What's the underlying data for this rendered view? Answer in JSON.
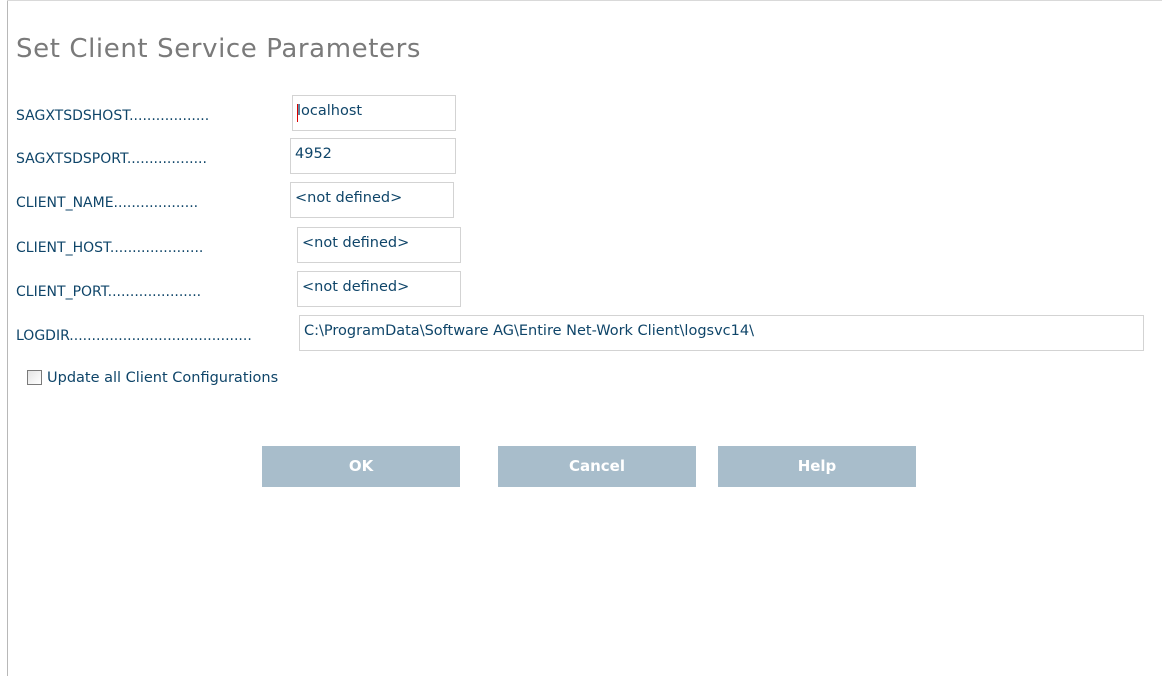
{
  "title": "Set Client Service Parameters",
  "fields": [
    {
      "label": "SAGXTSDSHOST..................",
      "value": "localhost"
    },
    {
      "label": "SAGXTSDSPORT..................",
      "value": "4952"
    },
    {
      "label": "CLIENT_NAME...................",
      "value": "<not defined>"
    },
    {
      "label": "CLIENT_HOST.....................",
      "value": "<not defined>"
    },
    {
      "label": "CLIENT_PORT.....................",
      "value": "<not defined>"
    },
    {
      "label": "LOGDIR.........................................",
      "value": "C:\\ProgramData\\Software AG\\Entire Net-Work Client\\logsvc14\\"
    }
  ],
  "checkbox": {
    "label": "Update all Client Configurations",
    "checked": false
  },
  "buttons": {
    "ok": "OK",
    "cancel": "Cancel",
    "help": "Help"
  },
  "colors": {
    "label_text": "#0f4569",
    "title_text": "#7a7a7a",
    "button_bg": "#a8bdcb",
    "button_text": "#ffffff"
  }
}
